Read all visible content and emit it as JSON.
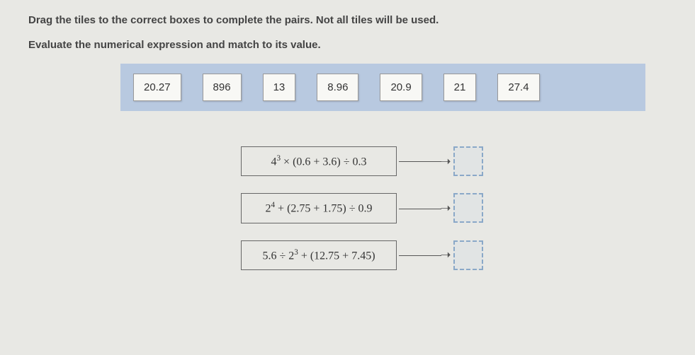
{
  "instructions": {
    "line1": "Drag the tiles to the correct boxes to complete the pairs. Not all tiles will be used.",
    "line2": "Evaluate the numerical expression and match to its value."
  },
  "tiles": [
    "20.27",
    "896",
    "13",
    "8.96",
    "20.9",
    "21",
    "27.4"
  ],
  "expressions": [
    {
      "base1": "4",
      "exp1": "3",
      "rest": " × (0.6 + 3.6) ÷ 0.3"
    },
    {
      "base1": "2",
      "exp1": "4",
      "rest": " + (2.75 + 1.75) ÷ 0.9"
    },
    {
      "pre": "5.6 ÷ ",
      "base1": "2",
      "exp1": "3",
      "rest": " + (12.75 + 7.45)"
    }
  ]
}
